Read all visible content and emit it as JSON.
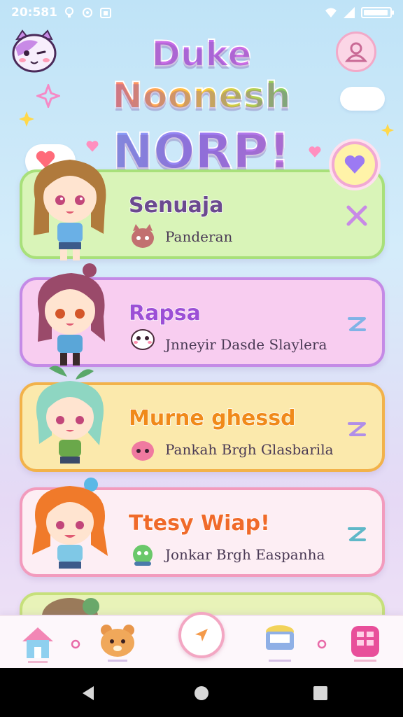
{
  "status_bar": {
    "time": "20:581"
  },
  "header": {
    "title_line1": "Duke",
    "title_line2": "Noonesh",
    "title_line3": "NORP!"
  },
  "cards": [
    {
      "title": "Senuaja",
      "subtitle": "Panderan",
      "action_icon": "close-x-icon",
      "title_color": "#6b4a8f",
      "bg": "#d9f4b8",
      "border": "#a8e07a",
      "action_color": "#c88ae6"
    },
    {
      "title": "Rapsa",
      "subtitle": "Jnneyir Dasde Slaylera",
      "action_icon": "swap-icon",
      "title_color": "#9c4fd6",
      "bg": "#f8cdf0",
      "border": "#c48ae6",
      "action_color": "#7fb3e6"
    },
    {
      "title": "Murnе ghessd",
      "subtitle": "Pankah Brgh Glasbarila",
      "action_icon": "swap-icon",
      "title_color": "#f08a1a",
      "bg": "#fbe9ac",
      "border": "#f2b24a",
      "action_color": "#b08ee8"
    },
    {
      "title": "Ttesy Wiap!",
      "subtitle": "Jonkar Brgh Easpanha",
      "action_icon": "swap-icon",
      "title_color": "#f06a2a",
      "bg": "#fdeef4",
      "border": "#f29bbd",
      "action_color": "#5fb8c8"
    }
  ],
  "colors": {
    "accent_pink": "#f3a7c3",
    "accent_purple": "#9c7af3"
  }
}
